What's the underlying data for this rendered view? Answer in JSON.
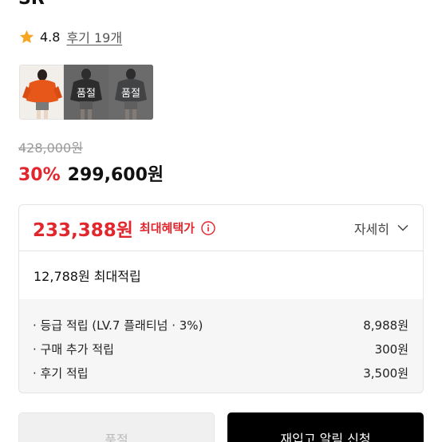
{
  "product": {
    "title_fragment": "SR"
  },
  "rating": {
    "score": "4.8",
    "review_link": "후기 19개",
    "star_color": "#f5a623"
  },
  "thumbnails": [
    {
      "name": "orange-jacket",
      "soldout": false,
      "overlay": ""
    },
    {
      "name": "black-jacket",
      "soldout": true,
      "overlay": "품절"
    },
    {
      "name": "gray-jacket",
      "soldout": true,
      "overlay": "품절"
    }
  ],
  "price": {
    "original": "428,000원",
    "discount_rate": "30%",
    "sale": "299,600원",
    "accent_color": "#e1262d"
  },
  "benefit": {
    "max_benefit_price": "233,388원",
    "max_benefit_label": "최대혜택가",
    "detail_label": "자세히",
    "points_summary": "12,788원 최대적립",
    "rows": [
      {
        "label": "· 등급 적립 (LV.7 플래티넘 · 3%)",
        "value": "8,988원"
      },
      {
        "label": "· 구매 추가 적립",
        "value": "300원"
      },
      {
        "label": "· 후기 적립",
        "value": "3,500원"
      }
    ]
  },
  "actions": {
    "soldout_label": "품절",
    "restock_label": "재입고 알림 신청"
  }
}
